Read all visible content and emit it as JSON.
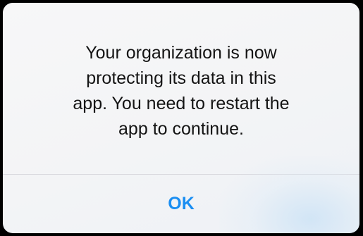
{
  "alert": {
    "message_lines": [
      "Your organization is now",
      "protecting its data in this",
      "app. You need to restart the",
      "app to continue."
    ],
    "ok_label": "OK",
    "accent_color": "#1a8ef2"
  }
}
